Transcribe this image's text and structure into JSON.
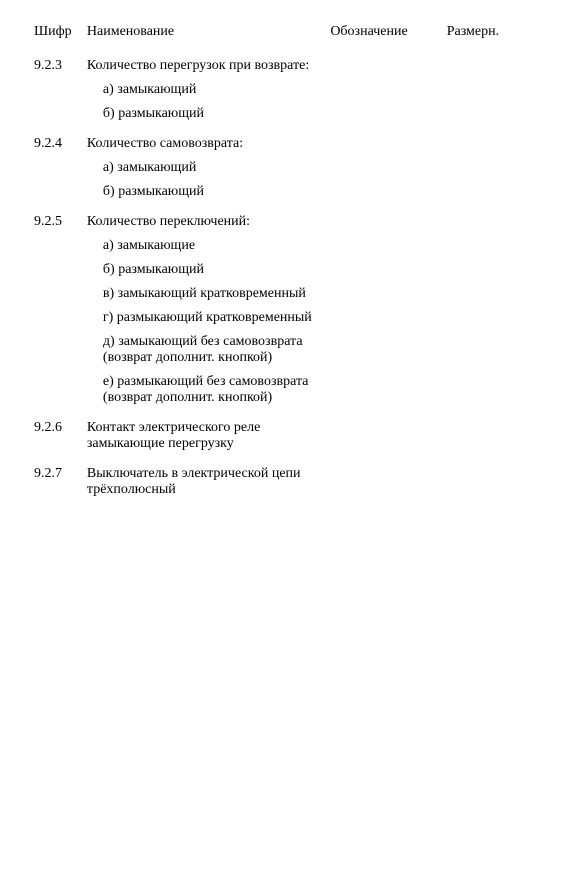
{
  "headers": {
    "num": "Шифр",
    "name": "Наименование",
    "ref": "Обозначение",
    "unit": "Размерн."
  },
  "rows": [
    {
      "num": "9.2.3",
      "name": "Количество перегрузок при возврате:"
    },
    {
      "name": "а) замыкающий",
      "cls": "sub"
    },
    {
      "name": "б) размыкающий",
      "cls": "sub"
    },
    {
      "num": "9.2.4",
      "name": "Количество самовозврата:",
      "gap": true
    },
    {
      "name": "а) замыкающий",
      "cls": "sub"
    },
    {
      "name": "б) размыкающий",
      "cls": "sub"
    },
    {
      "num": "9.2.5",
      "name": "Количество переключений:",
      "gap": true
    },
    {
      "name": "а) замыкающие",
      "cls": "sub"
    },
    {
      "name": "б) размыкающий",
      "cls": "sub"
    },
    {
      "name": "в) замыкающий кратковременный",
      "cls": "sub"
    },
    {
      "name": "г) размыкающий кратковременный",
      "cls": "sub"
    },
    {
      "name": "д) замыкающий без самовозврата (возврат дополнит. кнопкой)",
      "cls": "sub"
    },
    {
      "name": "е) размыкающий без самовозврата (возврат дополнит. кнопкой)",
      "cls": "sub"
    },
    {
      "num": "9.2.6",
      "name": "Контакт электрического реле замыкающие перегрузку",
      "gap": true
    },
    {
      "num": "9.2.7",
      "name": "Выключатель в электрической цепи трёхполюсный",
      "gap": true
    }
  ]
}
